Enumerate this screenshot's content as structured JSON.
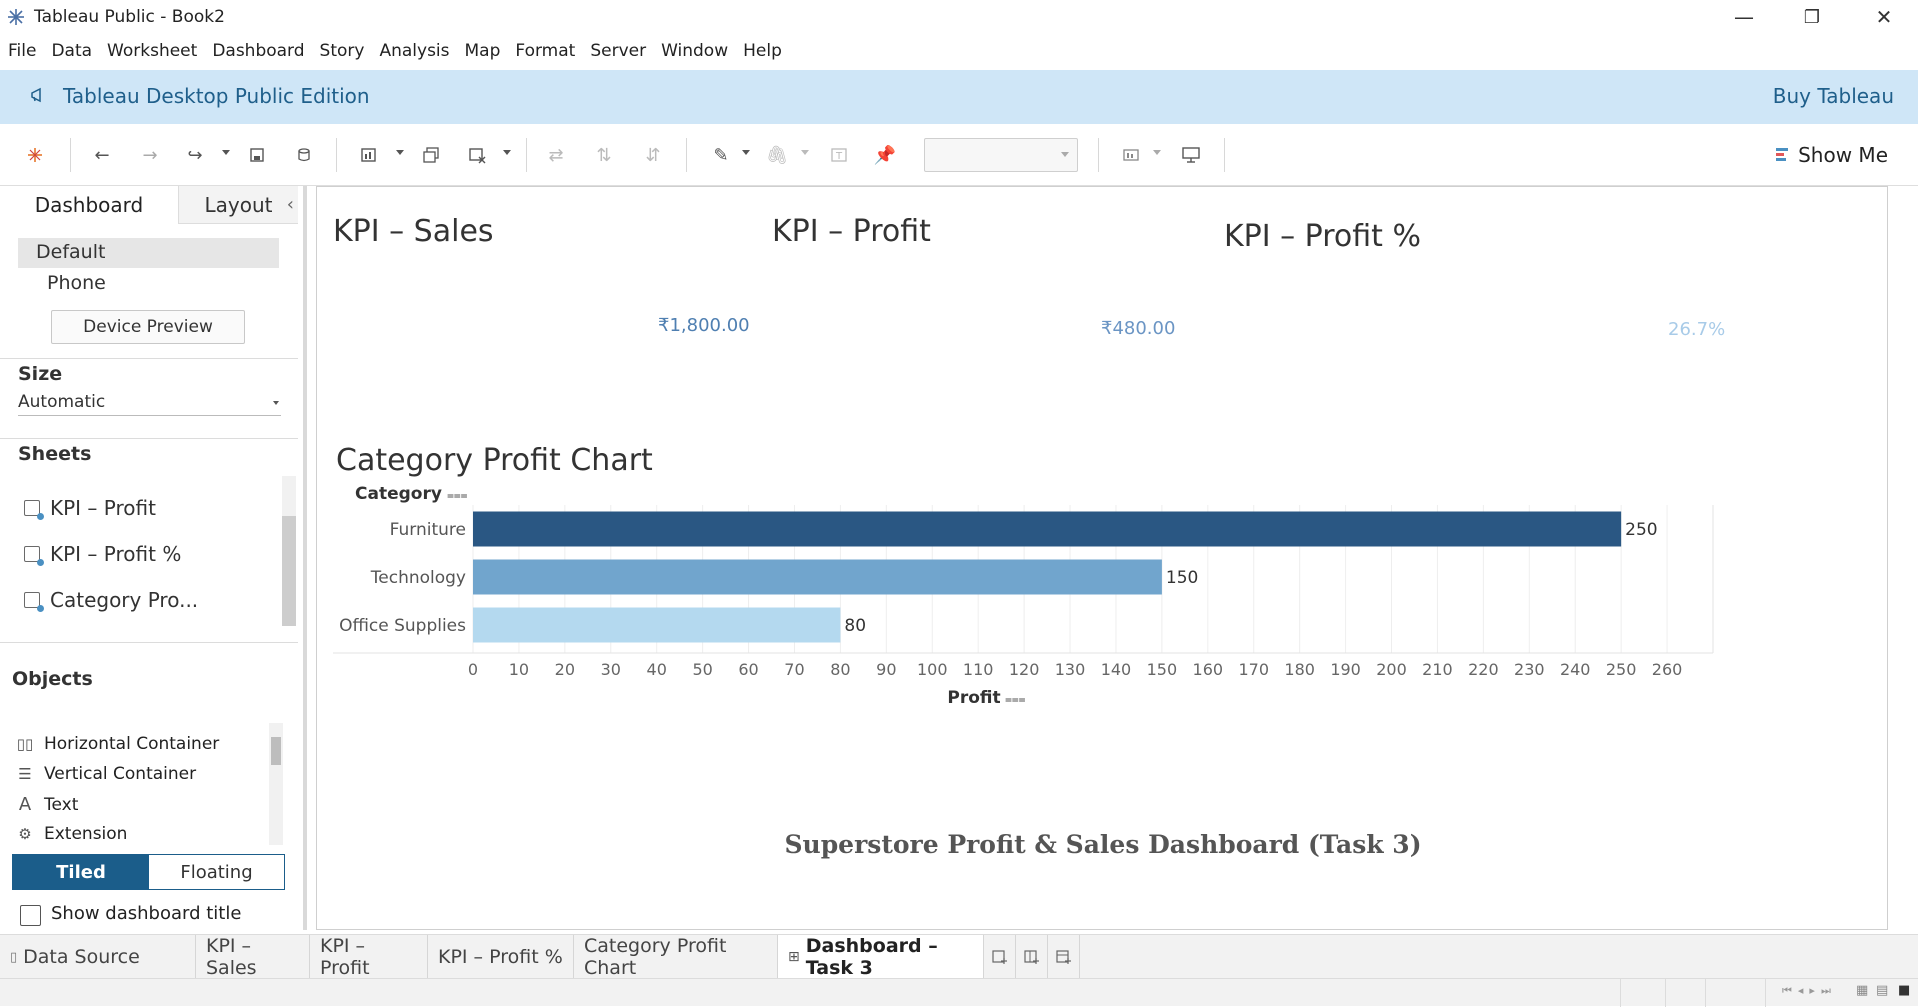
{
  "window": {
    "title": "Tableau Public - Book2",
    "minimize": "—",
    "restore": "❐",
    "close": "✕"
  },
  "menu": [
    "File",
    "Data",
    "Worksheet",
    "Dashboard",
    "Story",
    "Analysis",
    "Map",
    "Format",
    "Server",
    "Window",
    "Help"
  ],
  "banner": {
    "edition": "Tableau Desktop Public Edition",
    "buy": "Buy Tableau"
  },
  "toolbar": {
    "show_me": "Show Me"
  },
  "left_panel": {
    "tabs": [
      "Dashboard",
      "Layout"
    ],
    "collapse_icon": "‹",
    "device": {
      "default": "Default",
      "phone": "Phone",
      "preview_button": "Device Preview"
    },
    "size": {
      "title": "Size",
      "value": "Automatic"
    },
    "sheets": {
      "title": "Sheets",
      "items": [
        "KPI – Profit",
        "KPI – Profit %",
        "Category Pro..."
      ]
    },
    "objects": {
      "title": "Objects",
      "items": [
        {
          "label": "Horizontal Container",
          "icon": "horizontal-container-icon"
        },
        {
          "label": "Vertical Container",
          "icon": "vertical-container-icon"
        },
        {
          "label": "Text",
          "icon": "text-icon"
        },
        {
          "label": "Extension",
          "icon": "extension-icon"
        }
      ]
    },
    "layout_mode": {
      "tiled": "Tiled",
      "floating": "Floating",
      "selected": "Tiled"
    },
    "show_title": {
      "label": "Show dashboard title",
      "checked": false
    }
  },
  "dashboard": {
    "kpis": [
      {
        "title": "KPI – Sales",
        "value": "₹1,800.00",
        "color": "#4f7fb1"
      },
      {
        "title": "KPI – Profit",
        "value": "₹480.00",
        "color": "#6b95c4"
      },
      {
        "title": "KPI – Profit %",
        "value": "26.7%",
        "color": "#a8cbe8"
      }
    ],
    "footer_title": "Superstore Profit & Sales Dashboard (Task 3)"
  },
  "chart_data": {
    "type": "bar",
    "orientation": "horizontal",
    "title": "Category Profit Chart",
    "row_header": "Category",
    "xlabel": "Profit",
    "categories": [
      "Furniture",
      "Technology",
      "Office Supplies"
    ],
    "values": [
      250,
      150,
      80
    ],
    "colors": [
      "#2a5783",
      "#71a5cd",
      "#b4d9ef"
    ],
    "xlim": [
      0,
      270
    ],
    "xticks": [
      0,
      10,
      20,
      30,
      40,
      50,
      60,
      70,
      80,
      90,
      100,
      110,
      120,
      130,
      140,
      150,
      160,
      170,
      180,
      190,
      200,
      210,
      220,
      230,
      240,
      250,
      260
    ],
    "grid": true
  },
  "bottom_tabs": [
    {
      "label": "Data Source",
      "active": false
    },
    {
      "label": "KPI – Sales",
      "active": false
    },
    {
      "label": "KPI – Profit",
      "active": false
    },
    {
      "label": "KPI – Profit %",
      "active": false
    },
    {
      "label": "Category Profit Chart",
      "active": false
    },
    {
      "label": "Dashboard – Task 3",
      "active": true
    }
  ]
}
